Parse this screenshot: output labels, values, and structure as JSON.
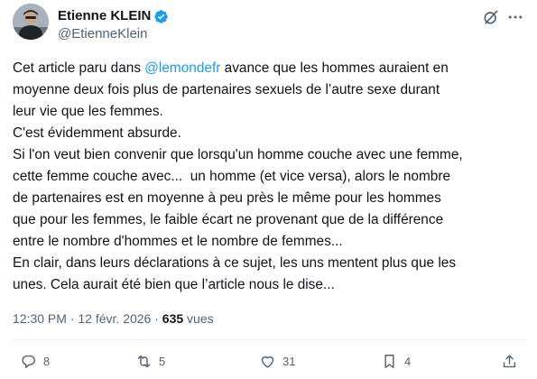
{
  "author": {
    "display_name": "Etienne KLEIN",
    "handle": "@EtienneKlein",
    "verified_icon": "verified-badge-icon",
    "avatar_icon": "profile-avatar"
  },
  "header_actions": {
    "grok_icon": "grok-icon",
    "more_icon": "more-dots-icon"
  },
  "tweet": {
    "line1_before": "Cet article paru dans ",
    "mention": "@lemondefr",
    "line1_after": " avance que les hommes auraient en",
    "line2": "moyenne deux fois plus de partenaires sexuels de l’autre sexe durant",
    "line3": "leur vie que les femmes.",
    "line4": "C'est évidemment absurde.",
    "line5": "Si l'on veut bien convenir que lorsqu'un homme couche avec une femme,",
    "line6": "cette femme couche avec...  un homme (et vice versa), alors le nombre",
    "line7": "de partenaires est en moyenne à peu près le même pour les hommes",
    "line8": "que pour les femmes, le faible écart ne provenant que de la différence",
    "line9": "entre le nombre d'hommes et le nombre de femmes...",
    "line10": "En clair, dans leurs déclarations à ce sujet, les uns mentent plus que les",
    "line11": "unes. Cela aurait été bien que l’article nous le dise..."
  },
  "meta": {
    "time": "12:30 PM",
    "separator": " · ",
    "date": "12 févr. 2026",
    "views_count": "635",
    "views_label": " vues"
  },
  "actions": {
    "replies": "8",
    "reposts": "5",
    "likes": "31",
    "bookmarks": "4"
  },
  "colors": {
    "accent": "#1d9bf0",
    "secondary_text": "#536471",
    "primary_text": "#0f1419"
  }
}
